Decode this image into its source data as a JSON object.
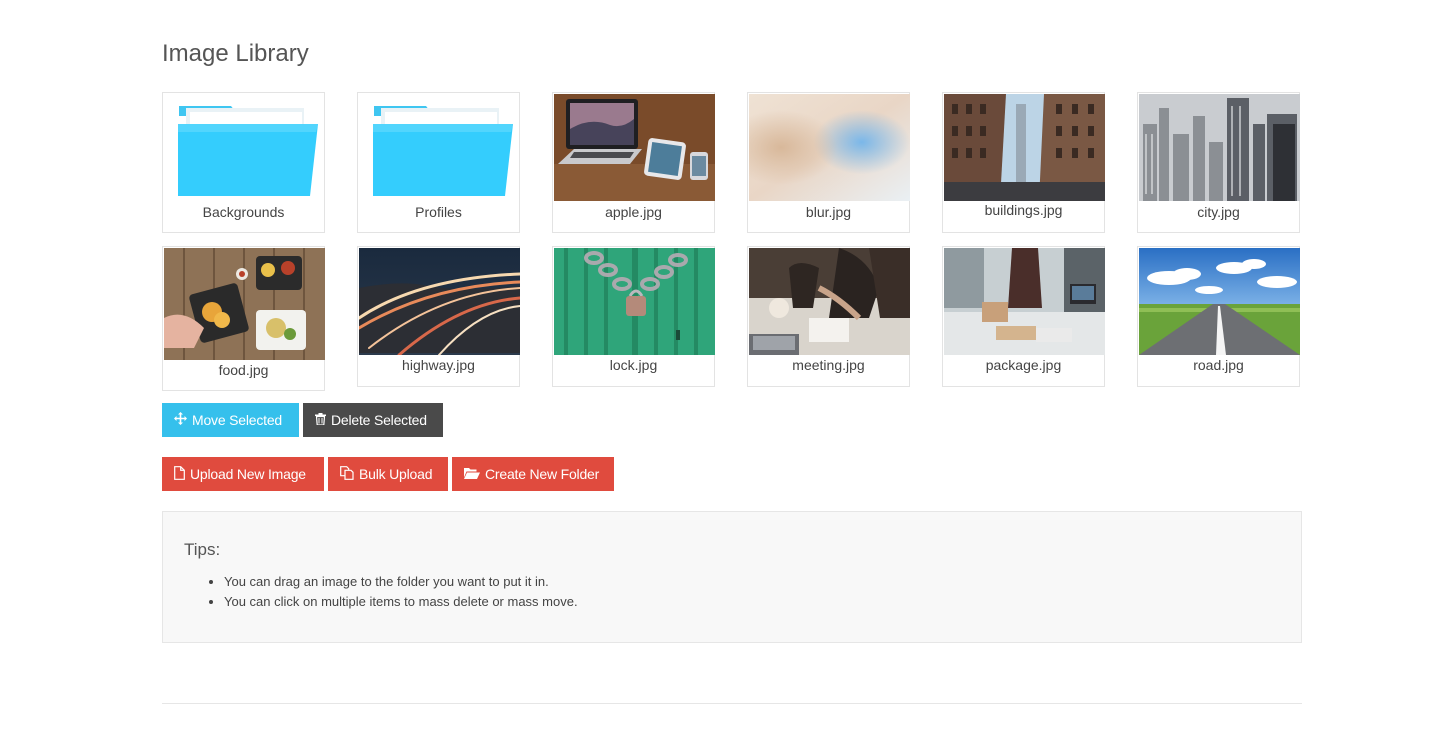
{
  "page": {
    "title": "Image Library"
  },
  "items": [
    {
      "name": "Backgrounds",
      "kind": "folder",
      "icon": "folder-icon"
    },
    {
      "name": "Profiles",
      "kind": "folder",
      "icon": "folder-icon"
    },
    {
      "name": "apple.jpg",
      "kind": "image"
    },
    {
      "name": "blur.jpg",
      "kind": "image"
    },
    {
      "name": "buildings.jpg",
      "kind": "image"
    },
    {
      "name": "city.jpg",
      "kind": "image"
    },
    {
      "name": "food.jpg",
      "kind": "image"
    },
    {
      "name": "highway.jpg",
      "kind": "image"
    },
    {
      "name": "lock.jpg",
      "kind": "image"
    },
    {
      "name": "meeting.jpg",
      "kind": "image"
    },
    {
      "name": "package.jpg",
      "kind": "image"
    },
    {
      "name": "road.jpg",
      "kind": "image"
    }
  ],
  "actions": {
    "move_selected": {
      "label": "Move Selected",
      "icon": "arrows-move-icon",
      "color": "#35c0ec"
    },
    "delete_selected": {
      "label": "Delete Selected",
      "icon": "trash-icon",
      "color": "#4a4a4a"
    }
  },
  "upload": {
    "upload_new_image": {
      "label": "Upload New Image",
      "icon": "file-icon",
      "color": "#e04b3e"
    },
    "bulk_upload": {
      "label": "Bulk Upload",
      "icon": "copy-icon",
      "color": "#e04b3e"
    },
    "create_new_folder": {
      "label": "Create New Folder",
      "icon": "folder-open-icon",
      "color": "#e04b3e"
    }
  },
  "tips": {
    "heading": "Tips:",
    "items": [
      "You can drag an image to the folder you want to put it in.",
      "You can click on multiple items to mass delete or mass move."
    ]
  }
}
